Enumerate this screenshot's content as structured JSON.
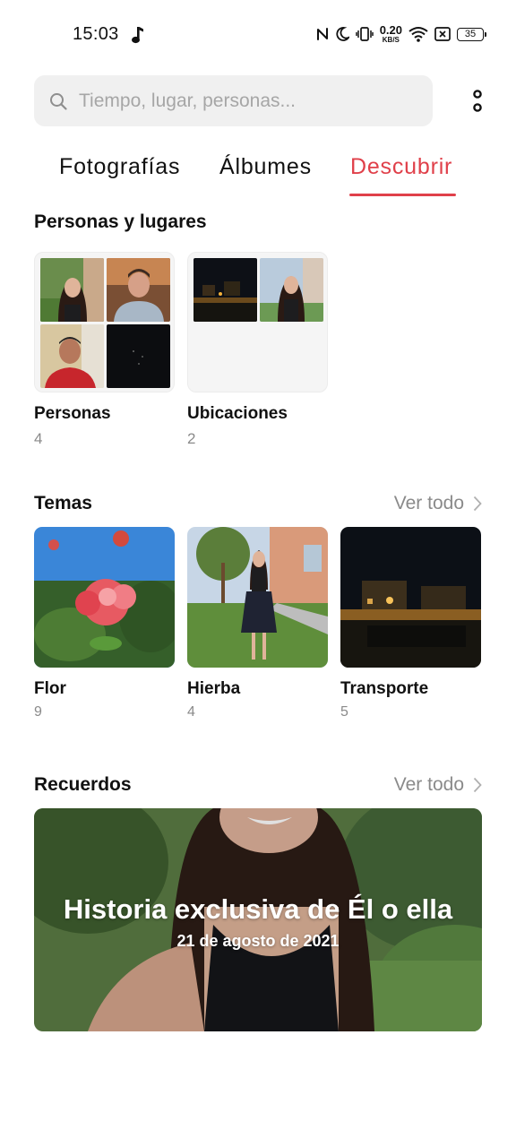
{
  "status_bar": {
    "time": "15:03",
    "net_speed_value": "0.20",
    "net_speed_unit": "KB/S",
    "battery_level": "35",
    "icons": [
      "music-note-icon",
      "nfc-icon",
      "moon-icon",
      "vibrate-icon",
      "wifi-icon",
      "sim-disabled-icon",
      "battery-icon"
    ]
  },
  "search": {
    "placeholder": "Tiempo, lugar, personas..."
  },
  "tabs": [
    {
      "label": "Fotografías",
      "active": false
    },
    {
      "label": "Álbumes",
      "active": false
    },
    {
      "label": "Descubrir",
      "active": true
    }
  ],
  "people_places": {
    "title": "Personas y lugares",
    "items": [
      {
        "label": "Personas",
        "count": "4"
      },
      {
        "label": "Ubicaciones",
        "count": "2"
      }
    ]
  },
  "themes": {
    "title": "Temas",
    "see_all": "Ver todo",
    "items": [
      {
        "label": "Flor",
        "count": "9"
      },
      {
        "label": "Hierba",
        "count": "4"
      },
      {
        "label": "Transporte",
        "count": "5"
      }
    ]
  },
  "memories": {
    "title": "Recuerdos",
    "see_all": "Ver todo",
    "card_title": "Historia exclusiva de Él o ella",
    "card_date": "21 de agosto de 2021"
  },
  "colors": {
    "accent": "#e0404a",
    "muted_text": "#8a8a8a",
    "search_bg": "#f0f0f0"
  }
}
